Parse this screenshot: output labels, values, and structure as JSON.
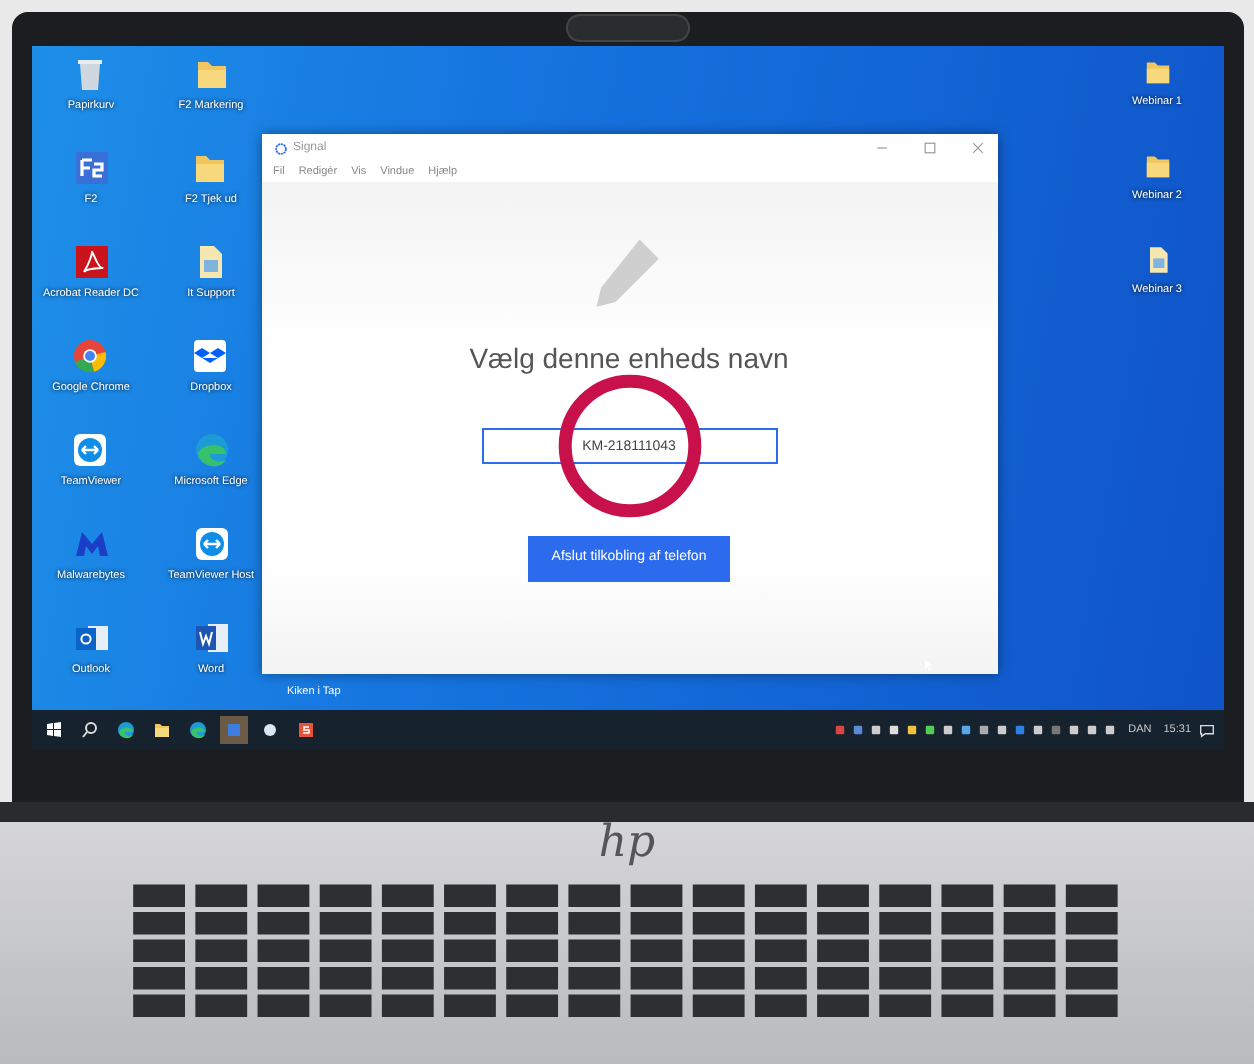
{
  "desktop": {
    "icon_columns": [
      [
        {
          "label": "Papirkurv",
          "kind": "trash"
        },
        {
          "label": "F2",
          "kind": "f2"
        },
        {
          "label": "Acrobat Reader DC",
          "kind": "pdf"
        },
        {
          "label": "Google Chrome",
          "kind": "chrome"
        },
        {
          "label": "TeamViewer",
          "kind": "remote"
        },
        {
          "label": "Malwarebytes",
          "kind": "shield"
        },
        {
          "label": "Outlook",
          "kind": "mail"
        }
      ],
      [
        {
          "label": "F2 Markering",
          "kind": "folder"
        },
        {
          "label": "F2 Tjek ud",
          "kind": "folder"
        },
        {
          "label": "It Support",
          "kind": "doc"
        },
        {
          "label": "Dropbox",
          "kind": "box"
        },
        {
          "label": "Microsoft Edge",
          "kind": "edge"
        },
        {
          "label": "TeamViewer Host",
          "kind": "remote"
        },
        {
          "label": "Word",
          "kind": "word"
        }
      ]
    ],
    "right_icons": [
      {
        "label": "Webinar 1",
        "kind": "folder"
      },
      {
        "label": "Webinar 2",
        "kind": "folder"
      },
      {
        "label": "Webinar 3",
        "kind": "doc"
      }
    ],
    "bottom_label": "Kiken i Tap"
  },
  "window": {
    "title": "Signal",
    "menu": [
      "Fil",
      "Redigér",
      "Vis",
      "Vindue",
      "Hjælp"
    ],
    "heading": "Vælg denne enheds navn",
    "field": {
      "value": "KM-218111043"
    },
    "button": "Afslut tilkobling af telefon"
  },
  "taskbar": {
    "apps": [
      {
        "kind": "start",
        "selected": false
      },
      {
        "kind": "search",
        "selected": false
      },
      {
        "kind": "edge",
        "selected": false
      },
      {
        "kind": "folder",
        "selected": false
      },
      {
        "kind": "edge",
        "selected": false
      },
      {
        "kind": "app",
        "selected": true
      },
      {
        "kind": "circle",
        "selected": false
      },
      {
        "kind": "s",
        "selected": false
      }
    ],
    "language": "DAN",
    "time": "15:31"
  },
  "laptop": {
    "logo": "hp"
  }
}
